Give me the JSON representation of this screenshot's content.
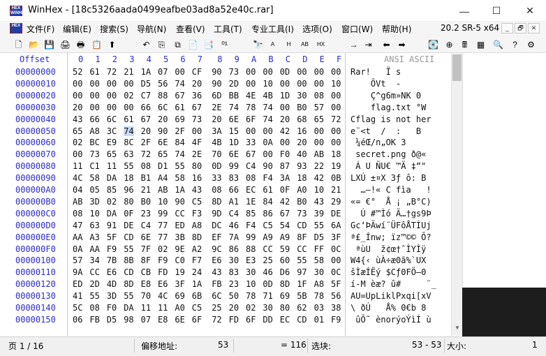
{
  "window": {
    "title": "WinHex - [18c5326aada0499eafbe03ad8a52e40c.rar]",
    "logo_text": [
      "HEX",
      "WINHEX"
    ],
    "minimize_icon": "—",
    "maximize_icon": "☐",
    "close_icon": "✕"
  },
  "menu": {
    "items": [
      "文件(F)",
      "编辑(E)",
      "搜索(S)",
      "导航(N)",
      "查看(V)",
      "工具(T)",
      "专业工具(I)",
      "选项(O)",
      "窗口(W)",
      "帮助(H)"
    ],
    "version": "20.2 SR-5 x64",
    "mdi_buttons": [
      "_",
      "🗗",
      "✕"
    ]
  },
  "toolbar": {
    "icons": [
      {
        "name": "new-file-icon",
        "glyph": "🗋"
      },
      {
        "name": "open-file-icon",
        "glyph": "📂"
      },
      {
        "name": "save-icon",
        "glyph": "💾"
      },
      {
        "name": "print-icon",
        "glyph": "🖨"
      },
      {
        "name": "properties-icon",
        "glyph": "🖶"
      },
      {
        "name": "config-icon",
        "glyph": "📋"
      },
      {
        "name": "export-icon",
        "glyph": "⬆"
      },
      {
        "name": "undo-icon",
        "glyph": "↶"
      },
      {
        "name": "copy-icon",
        "glyph": "⎘"
      },
      {
        "name": "cut-icon",
        "glyph": "⧉"
      },
      {
        "name": "paste-icon",
        "glyph": "📄"
      },
      {
        "name": "paste-special-icon",
        "glyph": "📑"
      },
      {
        "name": "convert-icon",
        "glyph": "⁰¹"
      },
      {
        "name": "find-icon",
        "glyph": "🔭"
      },
      {
        "name": "find-text-icon",
        "glyph": "A"
      },
      {
        "name": "find-hex-icon",
        "glyph": "H"
      },
      {
        "name": "replace-text-icon",
        "glyph": "AB"
      },
      {
        "name": "replace-hex-icon",
        "glyph": "HX"
      },
      {
        "name": "goto-offset-icon",
        "glyph": "→"
      },
      {
        "name": "goto-page-icon",
        "glyph": "⇥"
      },
      {
        "name": "back-icon",
        "glyph": "⬅"
      },
      {
        "name": "forward-icon",
        "glyph": "➡"
      },
      {
        "name": "disk-icon",
        "glyph": "💽"
      },
      {
        "name": "ram-icon",
        "glyph": "⊕"
      },
      {
        "name": "calculator-icon",
        "glyph": "🖩"
      },
      {
        "name": "table-icon",
        "glyph": "▦"
      },
      {
        "name": "search-icon",
        "glyph": "🔍"
      },
      {
        "name": "help-icon",
        "glyph": "?"
      },
      {
        "name": "settings-icon",
        "glyph": "⚙"
      }
    ]
  },
  "hex": {
    "offset_header": "Offset",
    "column_headers": [
      "0",
      "1",
      "2",
      "3",
      "4",
      "5",
      "6",
      "7",
      "8",
      "9",
      "A",
      "B",
      "C",
      "D",
      "E",
      "F"
    ],
    "ascii_header": "ANSI ASCII",
    "selected_offset": "00000053",
    "rows": [
      {
        "offset": "00000000",
        "bytes": [
          "52",
          "61",
          "72",
          "21",
          "1A",
          "07",
          "00",
          "CF",
          "90",
          "73",
          "00",
          "00",
          "0D",
          "00",
          "00",
          "00"
        ],
        "ascii": "Rar!   Ï s      "
      },
      {
        "offset": "00000010",
        "bytes": [
          "00",
          "00",
          "00",
          "00",
          "D5",
          "56",
          "74",
          "20",
          "90",
          "2D",
          "00",
          "10",
          "00",
          "00",
          "00",
          "10"
        ],
        "ascii": "    ÕVt  -      "
      },
      {
        "offset": "00000020",
        "bytes": [
          "00",
          "00",
          "00",
          "02",
          "C7",
          "88",
          "67",
          "36",
          "6D",
          "BB",
          "4E",
          "4B",
          "1D",
          "30",
          "08",
          "00"
        ],
        "ascii": "    Ç^g6m»NK 0  "
      },
      {
        "offset": "00000030",
        "bytes": [
          "20",
          "00",
          "00",
          "00",
          "66",
          "6C",
          "61",
          "67",
          "2E",
          "74",
          "78",
          "74",
          "00",
          "B0",
          "57",
          "00"
        ],
        "ascii": "    flag.txt °W "
      },
      {
        "offset": "00000040",
        "bytes": [
          "43",
          "66",
          "6C",
          "61",
          "67",
          "20",
          "69",
          "73",
          "20",
          "6E",
          "6F",
          "74",
          "20",
          "68",
          "65",
          "72"
        ],
        "ascii": "Cflag is not her"
      },
      {
        "offset": "00000050",
        "bytes": [
          "65",
          "A8",
          "3C",
          "74",
          "20",
          "90",
          "2F",
          "00",
          "3A",
          "15",
          "00",
          "00",
          "42",
          "16",
          "00",
          "00"
        ],
        "ascii": "e¨<t  /  :   B  "
      },
      {
        "offset": "00000060",
        "bytes": [
          "02",
          "BC",
          "E9",
          "8C",
          "2F",
          "6E",
          "84",
          "4F",
          "4B",
          "1D",
          "33",
          "0A",
          "00",
          "20",
          "00",
          "00"
        ],
        "ascii": " ¼éŒ/n„OK 3     "
      },
      {
        "offset": "00000070",
        "bytes": [
          "00",
          "73",
          "65",
          "63",
          "72",
          "65",
          "74",
          "2E",
          "70",
          "6E",
          "67",
          "00",
          "F0",
          "40",
          "AB",
          "18"
        ],
        "ascii": " secret.png ð@« "
      },
      {
        "offset": "00000080",
        "bytes": [
          "11",
          "C1",
          "11",
          "55",
          "08",
          "D1",
          "55",
          "80",
          "0D",
          "99",
          "C4",
          "90",
          "87",
          "93",
          "22",
          "19"
        ],
        "ascii": " Á U ÑU€ ™Ä ‡“\" "
      },
      {
        "offset": "00000090",
        "bytes": [
          "4C",
          "58",
          "DA",
          "18",
          "B1",
          "A4",
          "58",
          "16",
          "33",
          "83",
          "08",
          "F4",
          "3A",
          "18",
          "42",
          "0B"
        ],
        "ascii": "LXÚ ±¤X 3ƒ ô: B "
      },
      {
        "offset": "000000A0",
        "bytes": [
          "04",
          "05",
          "85",
          "96",
          "21",
          "AB",
          "1A",
          "43",
          "08",
          "66",
          "EC",
          "61",
          "0F",
          "A0",
          "10",
          "21"
        ],
        "ascii": "  …–!« C fìa   !"
      },
      {
        "offset": "000000B0",
        "bytes": [
          "AB",
          "3D",
          "02",
          "80",
          "B0",
          "10",
          "90",
          "C5",
          "8D",
          "A1",
          "1E",
          "84",
          "42",
          "B0",
          "43",
          "29"
        ],
        "ascii": "«= €°  Å ¡ „B°C)"
      },
      {
        "offset": "000000C0",
        "bytes": [
          "08",
          "10",
          "DA",
          "0F",
          "23",
          "99",
          "CC",
          "F3",
          "9D",
          "C4",
          "85",
          "86",
          "67",
          "73",
          "39",
          "DE"
        ],
        "ascii": "  Ú #™Ìó Ä…†gs9Þ"
      },
      {
        "offset": "000000D0",
        "bytes": [
          "47",
          "63",
          "91",
          "DE",
          "C4",
          "77",
          "ED",
          "A8",
          "DC",
          "46",
          "F4",
          "C5",
          "54",
          "CD",
          "55",
          "6A"
        ],
        "ascii": "Gc‘ÞÄwí¨ÜFôÅTÍUj"
      },
      {
        "offset": "000000E0",
        "bytes": [
          "AA",
          "A3",
          "5F",
          "CD",
          "6E",
          "77",
          "3B",
          "8D",
          "EF",
          "7A",
          "99",
          "A9",
          "A9",
          "8F",
          "D5",
          "3F"
        ],
        "ascii": "ª£_Ínw; ïz™©© Õ?"
      },
      {
        "offset": "000000F0",
        "bytes": [
          "0A",
          "AA",
          "F9",
          "55",
          "7F",
          "02",
          "9E",
          "A2",
          "9C",
          "86",
          "88",
          "CC",
          "59",
          "CC",
          "FF",
          "0C"
        ],
        "ascii": " ªùU  ž¢œ†ˆÌYÌÿ "
      },
      {
        "offset": "00000100",
        "bytes": [
          "57",
          "34",
          "7B",
          "8B",
          "8F",
          "F9",
          "C0",
          "F7",
          "E6",
          "30",
          "E3",
          "25",
          "60",
          "55",
          "58",
          "00"
        ],
        "ascii": "W4{‹ ùÀ÷æ0ã%`UX "
      },
      {
        "offset": "00000110",
        "bytes": [
          "9A",
          "CC",
          "E6",
          "CD",
          "CB",
          "FD",
          "19",
          "24",
          "43",
          "83",
          "30",
          "46",
          "D6",
          "97",
          "30",
          "0C"
        ],
        "ascii": "šÌæÍËý $Cƒ0FÖ—0 "
      },
      {
        "offset": "00000120",
        "bytes": [
          "ED",
          "2D",
          "4D",
          "8D",
          "E8",
          "E6",
          "3F",
          "1A",
          "FB",
          "23",
          "10",
          "0D",
          "8D",
          "1F",
          "A8",
          "5F"
        ],
        "ascii": "í-M èæ? û#     ¨_"
      },
      {
        "offset": "00000130",
        "bytes": [
          "41",
          "55",
          "3D",
          "55",
          "70",
          "4C",
          "69",
          "6B",
          "6C",
          "50",
          "78",
          "71",
          "69",
          "5B",
          "78",
          "56"
        ],
        "ascii": "AU=UpLiklPxqi[xV"
      },
      {
        "offset": "00000140",
        "bytes": [
          "5C",
          "08",
          "F0",
          "DA",
          "11",
          "11",
          "A0",
          "C5",
          "25",
          "20",
          "02",
          "30",
          "80",
          "62",
          "03",
          "38"
        ],
        "ascii": "\\ ðÚ   Å% 0€b 8"
      },
      {
        "offset": "00000150",
        "bytes": [
          "06",
          "FB",
          "D5",
          "98",
          "07",
          "E8",
          "6E",
          "6F",
          "72",
          "FD",
          "6F",
          "DD",
          "EC",
          "CD",
          "01",
          "F9"
        ],
        "ascii": " ûÕ˜ ènorýoÝìÍ ù"
      }
    ]
  },
  "status": {
    "page": "页 1 / 16",
    "offset_label": "偏移地址:",
    "offset_value": "53",
    "byte_value": "= 116",
    "selection_label": "选块:",
    "selection_value": "53 - 53",
    "size_label": "大小:",
    "size_value": "1"
  }
}
